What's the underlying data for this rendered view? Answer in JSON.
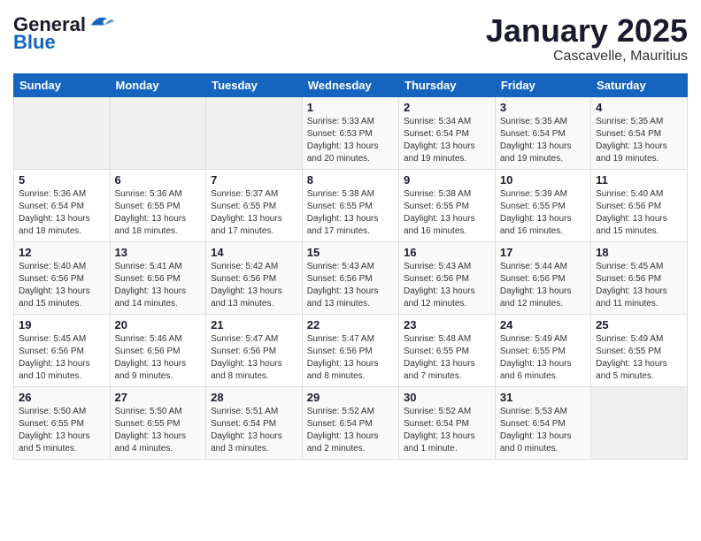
{
  "logo": {
    "line1": "General",
    "line2": "Blue"
  },
  "title": "January 2025",
  "location": "Cascavelle, Mauritius",
  "weekdays": [
    "Sunday",
    "Monday",
    "Tuesday",
    "Wednesday",
    "Thursday",
    "Friday",
    "Saturday"
  ],
  "weeks": [
    [
      {
        "day": "",
        "info": ""
      },
      {
        "day": "",
        "info": ""
      },
      {
        "day": "",
        "info": ""
      },
      {
        "day": "1",
        "info": "Sunrise: 5:33 AM\nSunset: 6:53 PM\nDaylight: 13 hours\nand 20 minutes."
      },
      {
        "day": "2",
        "info": "Sunrise: 5:34 AM\nSunset: 6:54 PM\nDaylight: 13 hours\nand 19 minutes."
      },
      {
        "day": "3",
        "info": "Sunrise: 5:35 AM\nSunset: 6:54 PM\nDaylight: 13 hours\nand 19 minutes."
      },
      {
        "day": "4",
        "info": "Sunrise: 5:35 AM\nSunset: 6:54 PM\nDaylight: 13 hours\nand 19 minutes."
      }
    ],
    [
      {
        "day": "5",
        "info": "Sunrise: 5:36 AM\nSunset: 6:54 PM\nDaylight: 13 hours\nand 18 minutes."
      },
      {
        "day": "6",
        "info": "Sunrise: 5:36 AM\nSunset: 6:55 PM\nDaylight: 13 hours\nand 18 minutes."
      },
      {
        "day": "7",
        "info": "Sunrise: 5:37 AM\nSunset: 6:55 PM\nDaylight: 13 hours\nand 17 minutes."
      },
      {
        "day": "8",
        "info": "Sunrise: 5:38 AM\nSunset: 6:55 PM\nDaylight: 13 hours\nand 17 minutes."
      },
      {
        "day": "9",
        "info": "Sunrise: 5:38 AM\nSunset: 6:55 PM\nDaylight: 13 hours\nand 16 minutes."
      },
      {
        "day": "10",
        "info": "Sunrise: 5:39 AM\nSunset: 6:55 PM\nDaylight: 13 hours\nand 16 minutes."
      },
      {
        "day": "11",
        "info": "Sunrise: 5:40 AM\nSunset: 6:56 PM\nDaylight: 13 hours\nand 15 minutes."
      }
    ],
    [
      {
        "day": "12",
        "info": "Sunrise: 5:40 AM\nSunset: 6:56 PM\nDaylight: 13 hours\nand 15 minutes."
      },
      {
        "day": "13",
        "info": "Sunrise: 5:41 AM\nSunset: 6:56 PM\nDaylight: 13 hours\nand 14 minutes."
      },
      {
        "day": "14",
        "info": "Sunrise: 5:42 AM\nSunset: 6:56 PM\nDaylight: 13 hours\nand 13 minutes."
      },
      {
        "day": "15",
        "info": "Sunrise: 5:43 AM\nSunset: 6:56 PM\nDaylight: 13 hours\nand 13 minutes."
      },
      {
        "day": "16",
        "info": "Sunrise: 5:43 AM\nSunset: 6:56 PM\nDaylight: 13 hours\nand 12 minutes."
      },
      {
        "day": "17",
        "info": "Sunrise: 5:44 AM\nSunset: 6:56 PM\nDaylight: 13 hours\nand 12 minutes."
      },
      {
        "day": "18",
        "info": "Sunrise: 5:45 AM\nSunset: 6:56 PM\nDaylight: 13 hours\nand 11 minutes."
      }
    ],
    [
      {
        "day": "19",
        "info": "Sunrise: 5:45 AM\nSunset: 6:56 PM\nDaylight: 13 hours\nand 10 minutes."
      },
      {
        "day": "20",
        "info": "Sunrise: 5:46 AM\nSunset: 6:56 PM\nDaylight: 13 hours\nand 9 minutes."
      },
      {
        "day": "21",
        "info": "Sunrise: 5:47 AM\nSunset: 6:56 PM\nDaylight: 13 hours\nand 8 minutes."
      },
      {
        "day": "22",
        "info": "Sunrise: 5:47 AM\nSunset: 6:56 PM\nDaylight: 13 hours\nand 8 minutes."
      },
      {
        "day": "23",
        "info": "Sunrise: 5:48 AM\nSunset: 6:55 PM\nDaylight: 13 hours\nand 7 minutes."
      },
      {
        "day": "24",
        "info": "Sunrise: 5:49 AM\nSunset: 6:55 PM\nDaylight: 13 hours\nand 6 minutes."
      },
      {
        "day": "25",
        "info": "Sunrise: 5:49 AM\nSunset: 6:55 PM\nDaylight: 13 hours\nand 5 minutes."
      }
    ],
    [
      {
        "day": "26",
        "info": "Sunrise: 5:50 AM\nSunset: 6:55 PM\nDaylight: 13 hours\nand 5 minutes."
      },
      {
        "day": "27",
        "info": "Sunrise: 5:50 AM\nSunset: 6:55 PM\nDaylight: 13 hours\nand 4 minutes."
      },
      {
        "day": "28",
        "info": "Sunrise: 5:51 AM\nSunset: 6:54 PM\nDaylight: 13 hours\nand 3 minutes."
      },
      {
        "day": "29",
        "info": "Sunrise: 5:52 AM\nSunset: 6:54 PM\nDaylight: 13 hours\nand 2 minutes."
      },
      {
        "day": "30",
        "info": "Sunrise: 5:52 AM\nSunset: 6:54 PM\nDaylight: 13 hours\nand 1 minute."
      },
      {
        "day": "31",
        "info": "Sunrise: 5:53 AM\nSunset: 6:54 PM\nDaylight: 13 hours\nand 0 minutes."
      },
      {
        "day": "",
        "info": ""
      }
    ]
  ]
}
